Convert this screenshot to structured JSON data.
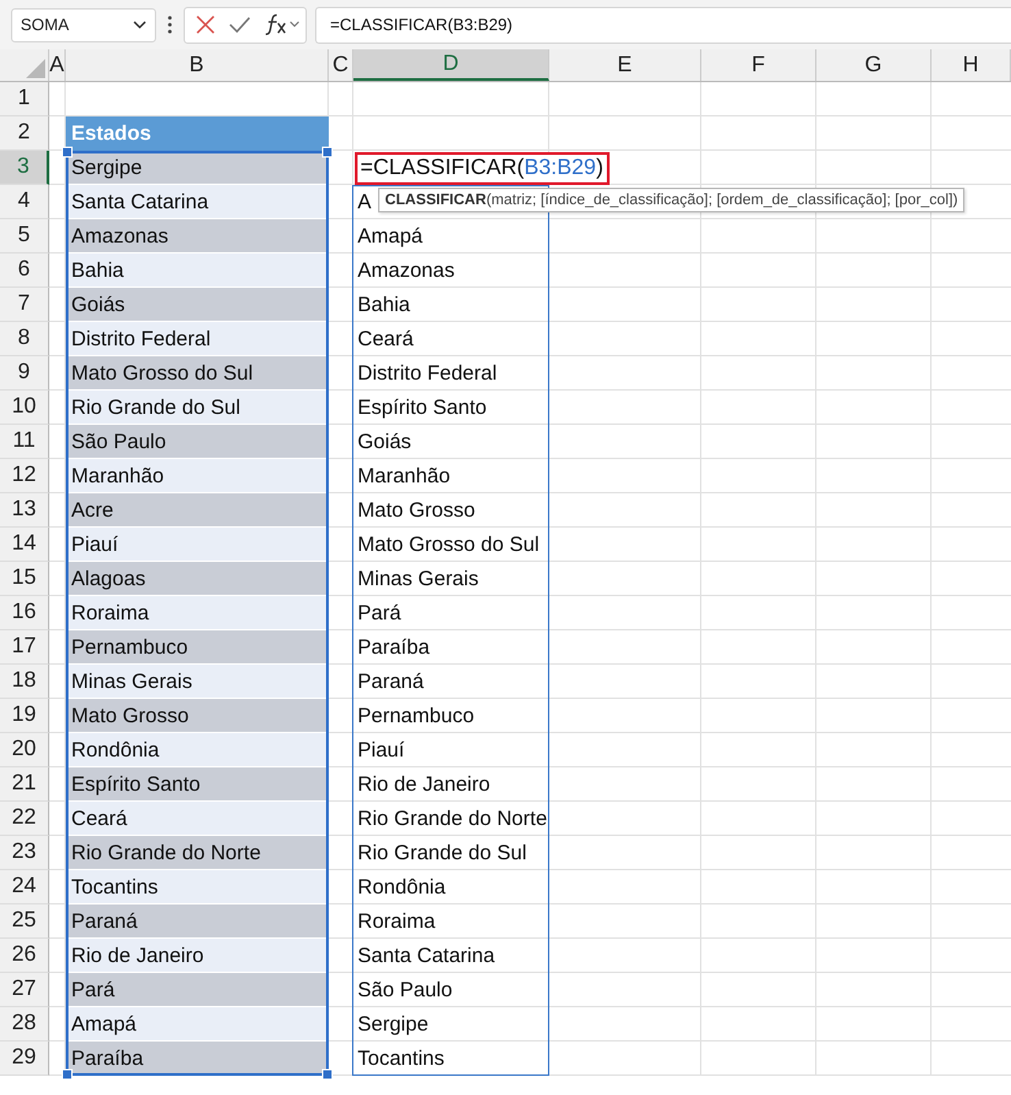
{
  "name_box": {
    "value": "SOMA"
  },
  "formula_bar": {
    "value": "=CLASSIFICAR(B3:B29)"
  },
  "columns": [
    {
      "label": "A",
      "selected": false
    },
    {
      "label": "B",
      "selected": false
    },
    {
      "label": "C",
      "selected": false
    },
    {
      "label": "D",
      "selected": true
    },
    {
      "label": "E",
      "selected": false
    },
    {
      "label": "F",
      "selected": false
    },
    {
      "label": "G",
      "selected": false
    },
    {
      "label": "H",
      "selected": false
    }
  ],
  "rows": [
    {
      "label": "1",
      "selected": false
    },
    {
      "label": "2",
      "selected": false
    },
    {
      "label": "3",
      "selected": true
    },
    {
      "label": "4",
      "selected": false
    },
    {
      "label": "5",
      "selected": false
    },
    {
      "label": "6",
      "selected": false
    },
    {
      "label": "7",
      "selected": false
    },
    {
      "label": "8",
      "selected": false
    },
    {
      "label": "9",
      "selected": false
    },
    {
      "label": "10",
      "selected": false
    },
    {
      "label": "11",
      "selected": false
    },
    {
      "label": "12",
      "selected": false
    },
    {
      "label": "13",
      "selected": false
    },
    {
      "label": "14",
      "selected": false
    },
    {
      "label": "15",
      "selected": false
    },
    {
      "label": "16",
      "selected": false
    },
    {
      "label": "17",
      "selected": false
    },
    {
      "label": "18",
      "selected": false
    },
    {
      "label": "19",
      "selected": false
    },
    {
      "label": "20",
      "selected": false
    },
    {
      "label": "21",
      "selected": false
    },
    {
      "label": "22",
      "selected": false
    },
    {
      "label": "23",
      "selected": false
    },
    {
      "label": "24",
      "selected": false
    },
    {
      "label": "25",
      "selected": false
    },
    {
      "label": "26",
      "selected": false
    },
    {
      "label": "27",
      "selected": false
    },
    {
      "label": "28",
      "selected": false
    },
    {
      "label": "29",
      "selected": false
    }
  ],
  "table": {
    "header": "Estados",
    "rows": [
      "Sergipe",
      "Santa Catarina",
      "Amazonas",
      "Bahia",
      "Goiás",
      "Distrito Federal",
      "Mato Grosso do Sul",
      "Rio Grande do Sul",
      "São Paulo",
      "Maranhão",
      "Acre",
      "Piauí",
      "Alagoas",
      "Roraima",
      "Pernambuco",
      "Minas Gerais",
      "Mato Grosso",
      "Rondônia",
      "Espírito Santo",
      "Ceará",
      "Rio Grande do Norte",
      "Tocantins",
      "Paraná",
      "Rio de Janeiro",
      "Pará",
      "Amapá",
      "Paraíba"
    ]
  },
  "formula_cell": {
    "prefix": "=CLASSIFICAR(",
    "ref": "B3:B29",
    "suffix": ")"
  },
  "tooltip": {
    "function": "CLASSIFICAR",
    "args": "(matriz; [índice_de_classificação]; [ordem_de_classificação]; [por_col])"
  },
  "spill": [
    "A",
    "Amapá",
    "Amazonas",
    "Bahia",
    "Ceará",
    "Distrito Federal",
    "Espírito Santo",
    "Goiás",
    "Maranhão",
    "Mato Grosso",
    "Mato Grosso do Sul",
    "Minas Gerais",
    "Pará",
    "Paraíba",
    "Paraná",
    "Pernambuco",
    "Piauí",
    "Rio de Janeiro",
    "Rio Grande do Norte",
    "Rio Grande do Sul",
    "Rondônia",
    "Roraima",
    "Santa Catarina",
    "São Paulo",
    "Sergipe",
    "Tocantins"
  ]
}
